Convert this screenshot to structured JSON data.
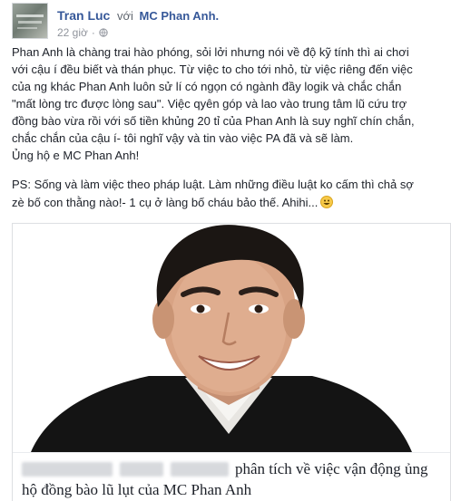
{
  "post": {
    "author_name": "Tran Luc",
    "with_word": "với",
    "tagged_name": "MC Phan Anh.",
    "timestamp": "22 giờ",
    "separator": "·",
    "privacy_icon": "globe-icon",
    "body_lines": [
      "Phan Anh là chàng trai hào phóng, sỏi lởi nhưng nói về độ kỹ tính thì ai chơi",
      "với cậu í đều biết và thán phục. Từ việc to cho tới nhỏ, từ việc riêng đến việc",
      "của ng khác Phan Anh luôn sử lí có ngọn có ngành đầy logik và chắc chắn",
      "\"mất lòng trc được lòng sau\". Việc qyên góp và lao vào trung tâm lũ cứu trợ",
      "đồng bào vừa rồi với số tiền khủng 20 tỉ của Phan Anh là suy nghĩ chín chắn,",
      "chắc chắn của cậu í- tôi nghĩ vậy và tin vào việc PA đã và sẽ làm.",
      "Ủng hộ e MC Phan Anh!"
    ],
    "ps_lines": [
      "PS: Sống và làm việc theo pháp luật. Làm những điều luật ko cấm thì chả sợ",
      "zè bố con thằng nào!- 1 cụ ở làng bố cháu bảo thế. Ahihi..."
    ],
    "emoji_icon": "grinning-emoji-icon"
  },
  "shared_photo": {
    "caption_line1": "phân tích về việc vận động ủng",
    "caption_line2": "hộ đồng bào lũ lụt của MC Phan Anh"
  },
  "colors": {
    "link_blue": "#365899",
    "meta_gray": "#90949c",
    "text_dark": "#1d2129"
  }
}
